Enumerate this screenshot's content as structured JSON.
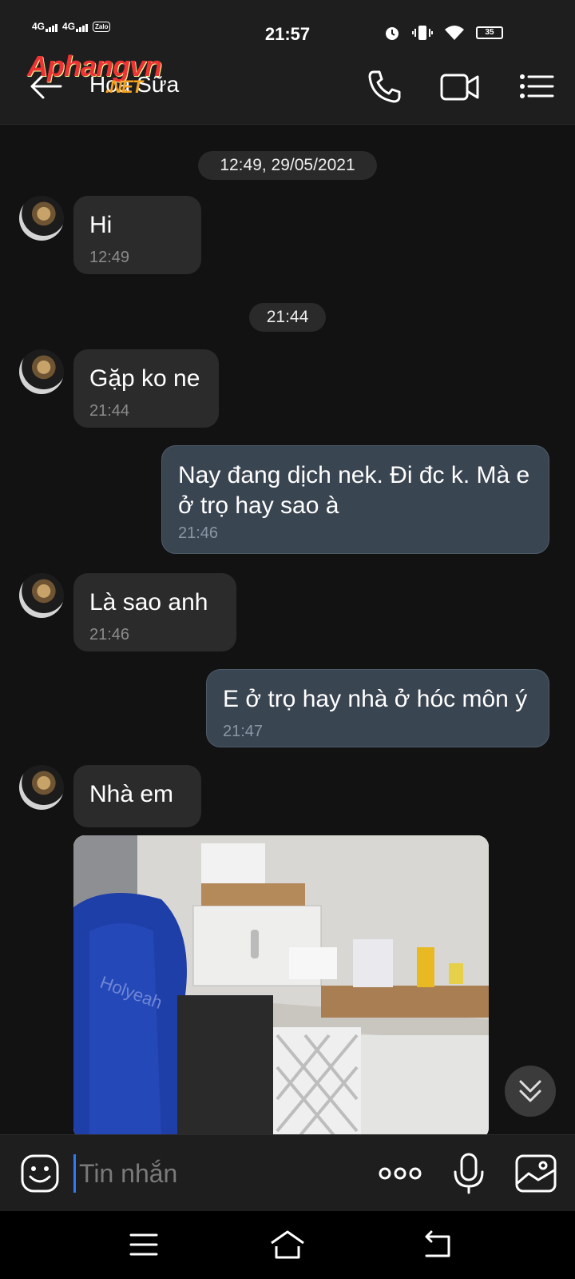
{
  "status_bar": {
    "time": "21:57",
    "network_1": "4G",
    "network_2": "4G",
    "carrier_app": "Zalo",
    "battery": "35"
  },
  "header": {
    "contact_name": "Hoa Sữa",
    "watermark_main": "Aphangvn",
    "watermark_sub": ".NET"
  },
  "messages": [
    {
      "type": "time",
      "text": "12:49, 29/05/2021"
    },
    {
      "type": "in",
      "text": "Hi",
      "time": "12:49"
    },
    {
      "type": "time",
      "text": "21:44"
    },
    {
      "type": "in",
      "text": "Gặp ko ne",
      "time": "21:44"
    },
    {
      "type": "out",
      "text": "Nay đang dịch nek. Đi đc k. Mà e ở trọ hay sao à",
      "time": "21:46"
    },
    {
      "type": "in",
      "text": "Là sao anh",
      "time": "21:46"
    },
    {
      "type": "out",
      "text": "E ở trọ hay nhà ở hóc môn ý",
      "time": "21:47"
    },
    {
      "type": "in",
      "text": "Nhà em"
    }
  ],
  "photo": {
    "caption_text": "Holyeah"
  },
  "input": {
    "placeholder": "Tin nhắn"
  },
  "colors": {
    "accent": "#2d7bf6",
    "outgoing_bubble": "#3a4552",
    "incoming_bubble": "#2b2b2b"
  },
  "icons": [
    "back-arrow-icon",
    "phone-icon",
    "video-call-icon",
    "menu-list-icon",
    "emoji-icon",
    "more-icon",
    "microphone-icon",
    "image-icon",
    "chevron-double-down-icon"
  ]
}
